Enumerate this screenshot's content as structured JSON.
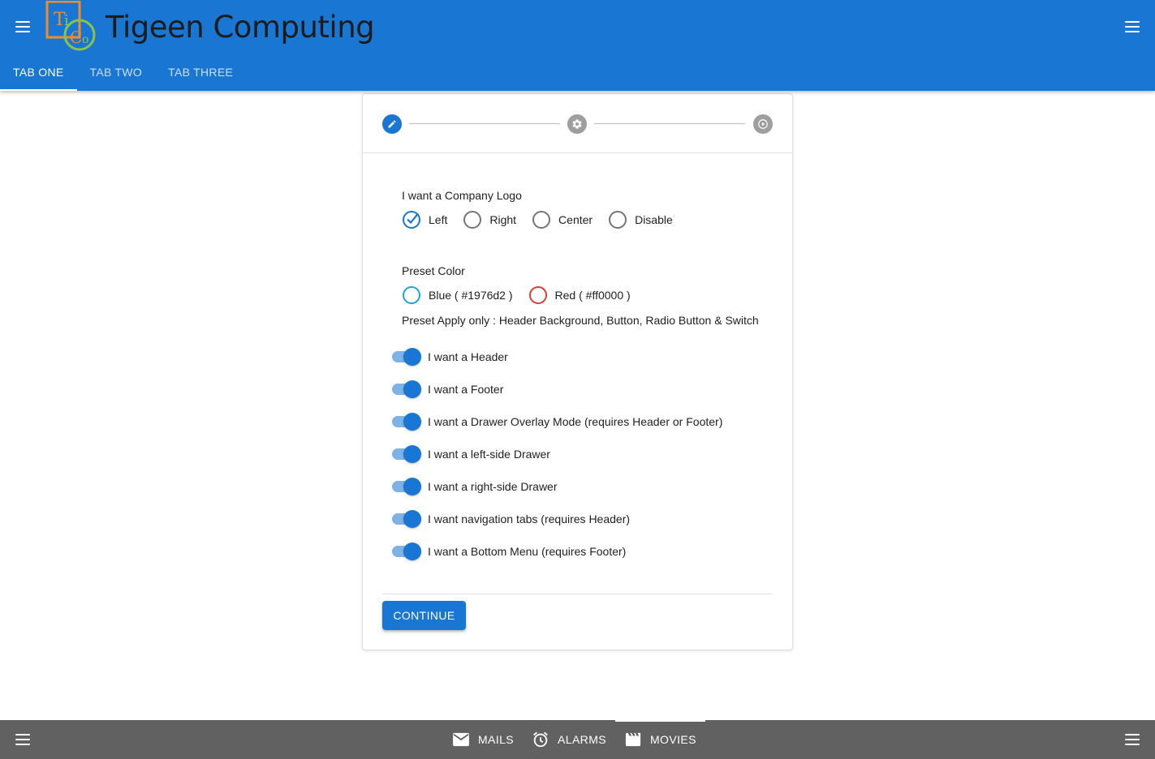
{
  "header": {
    "brand": "Tigeen Computing",
    "logo_letters": "TiCo",
    "tabs": [
      {
        "label": "TAB ONE",
        "active": true
      },
      {
        "label": "TAB TWO",
        "active": false
      },
      {
        "label": "TAB THREE",
        "active": false
      }
    ]
  },
  "stepper": {
    "steps": [
      {
        "icon": "pencil-icon",
        "state": "active"
      },
      {
        "icon": "gear-icon",
        "state": "inactive"
      },
      {
        "icon": "play-circle-icon",
        "state": "inactive"
      }
    ]
  },
  "form": {
    "logo_question": "I want a Company Logo",
    "logo_options": [
      {
        "label": "Left",
        "checked": true
      },
      {
        "label": "Right",
        "checked": false
      },
      {
        "label": "Center",
        "checked": false
      },
      {
        "label": "Disable",
        "checked": false
      }
    ],
    "preset_label": "Preset Color",
    "preset_options": [
      {
        "label": "Blue ( #1976d2 )",
        "color": "#1976d2"
      },
      {
        "label": "Red ( #ff0000 )",
        "color": "#ff0000"
      }
    ],
    "preset_note": "Preset Apply only : Header Background, Button, Radio Button & Switch",
    "switches": [
      {
        "label": "I want a Header",
        "on": true
      },
      {
        "label": "I want a Footer",
        "on": true
      },
      {
        "label": "I want a Drawer Overlay Mode (requires Header or Footer)",
        "on": true
      },
      {
        "label": "I want a left-side Drawer",
        "on": true
      },
      {
        "label": "I want a right-side Drawer",
        "on": true
      },
      {
        "label": "I want navigation tabs (requires Header)",
        "on": true
      },
      {
        "label": "I want a Bottom Menu (requires Footer)",
        "on": true
      }
    ],
    "continue_label": "CONTINUE"
  },
  "footer": {
    "items": [
      {
        "label": "MAILS",
        "icon": "mail-icon",
        "active": false
      },
      {
        "label": "ALARMS",
        "icon": "alarm-icon",
        "active": false
      },
      {
        "label": "MOVIES",
        "icon": "movie-icon",
        "active": true
      }
    ]
  },
  "colors": {
    "primary": "#1976d2",
    "footer_bg": "#616161",
    "red": "#ff0000"
  }
}
